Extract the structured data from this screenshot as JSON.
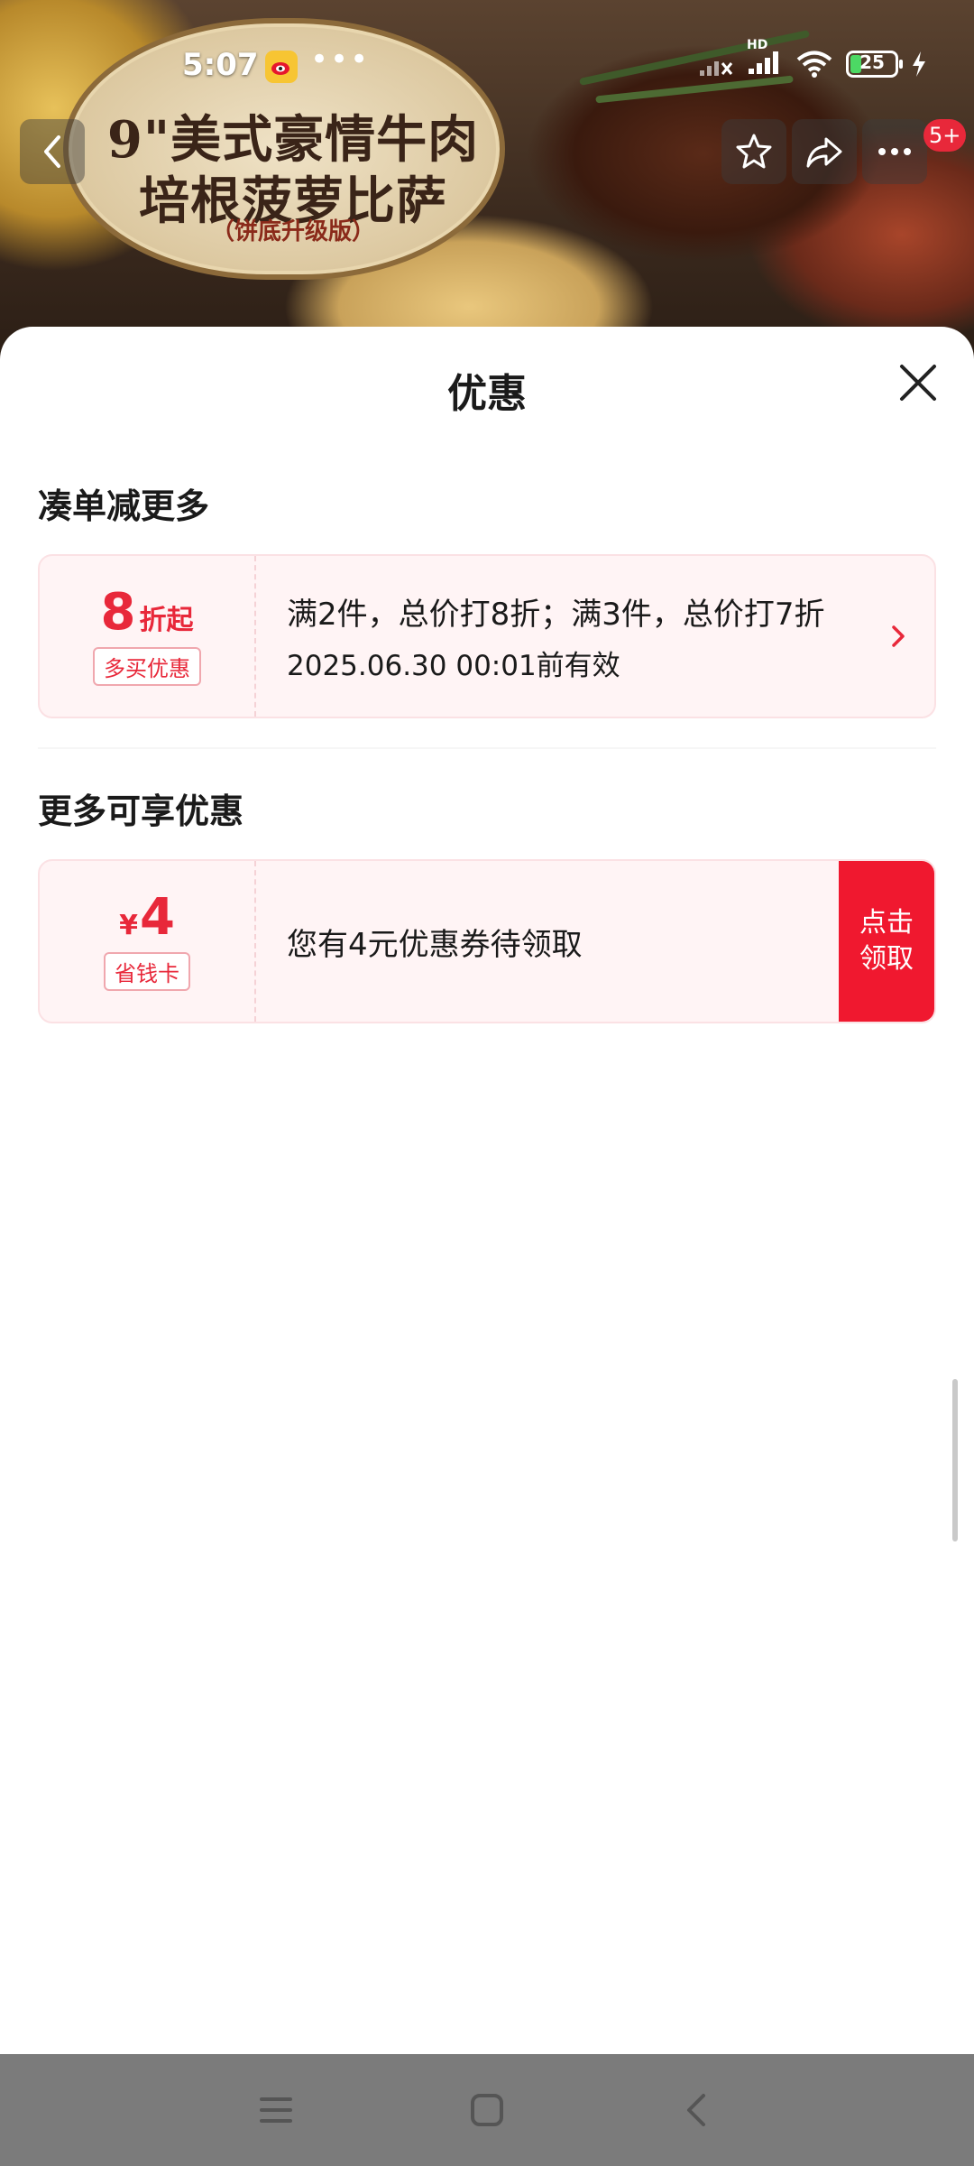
{
  "banner": {
    "title_line1": "9\"美式豪情牛肉",
    "title_line2": "培根菠萝比萨",
    "subtitle": "（饼底升级版）"
  },
  "status_bar": {
    "time": "5:07",
    "network_label": "HD",
    "battery_level": "25",
    "icons": [
      "weibo-app-icon",
      "more-dots-icon",
      "signal-off-icon",
      "signal-icon",
      "wifi-icon",
      "battery-icon",
      "charging-icon"
    ]
  },
  "top_nav": {
    "notification_badge": "5+",
    "icons": [
      "back-icon",
      "star-icon",
      "share-icon",
      "more-icon"
    ]
  },
  "sheet": {
    "title": "优惠",
    "section1": {
      "title": "凑单减更多",
      "offer": {
        "amount": "8",
        "amount_suffix": "折起",
        "tag": "多买优惠",
        "line1": "满2件，总价打8折；满3件，总价打7折",
        "line2": "2025.06.30 00:01前有效"
      }
    },
    "section2": {
      "title": "更多可享优惠",
      "offer": {
        "currency": "¥",
        "amount": "4",
        "tag": "省钱卡",
        "text": "您有4元优惠券待领取",
        "claim_line1": "点击",
        "claim_line2": "领取"
      }
    }
  },
  "colors": {
    "accent_red": "#e8283a",
    "claim_red": "#f0182f",
    "card_bg": "#fff4f5",
    "nav_bar_gray": "#7b7b7b"
  }
}
